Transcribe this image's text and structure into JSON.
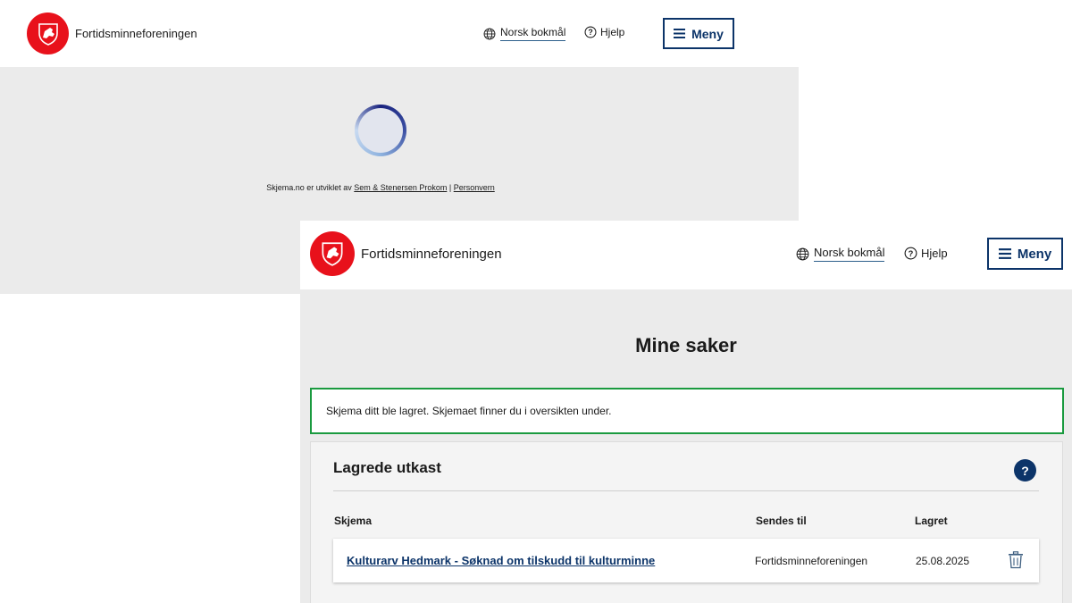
{
  "back_window": {
    "brand": "Fortidsminneforeningen",
    "language": "Norsk bokmål",
    "help": "Hjelp",
    "menu": "Meny",
    "footer": {
      "prefix": "Skjema.no er utviklet av",
      "developer_link": "Sem & Stenersen Prokom",
      "separator": "|",
      "privacy_link": "Personvern"
    }
  },
  "front_window": {
    "brand": "Fortidsminneforeningen",
    "language": "Norsk bokmål",
    "help": "Hjelp",
    "menu": "Meny",
    "page_title": "Mine saker",
    "alert": "Skjema ditt ble lagret. Skjemaet finner du i oversikten under.",
    "panel": {
      "title": "Lagrede utkast",
      "help_glyph": "?",
      "columns": [
        "Skjema",
        "Sendes til",
        "Lagret"
      ],
      "rows": [
        {
          "form": "Kulturarv Hedmark - Søknad om tilskudd til kulturminne",
          "recipient": "Fortidsminneforeningen",
          "saved": "25.08.2025"
        }
      ]
    }
  },
  "icons": {
    "logo": "heraldic-lion-logo-icon",
    "globe": "globe-icon",
    "help": "question-circle-icon",
    "menu": "hamburger-icon",
    "delete": "trash-icon",
    "spinner": "loading-spinner-icon"
  },
  "colors": {
    "brand_red": "#e8111b",
    "primary_navy": "#0c3469",
    "success_green": "#1a9a3f",
    "page_bg": "#ebebeb"
  }
}
